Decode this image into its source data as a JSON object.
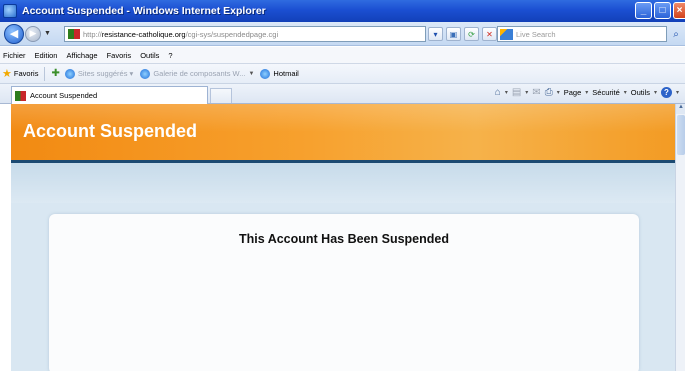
{
  "window": {
    "title": "Account Suspended - Windows Internet Explorer",
    "min_glyph": "_",
    "max_glyph": "□",
    "close_glyph": "×"
  },
  "address": {
    "url_prefix": "http://",
    "url_domain": "resistance-catholique.org",
    "url_path": "/cgi-sys/suspendedpage.cgi",
    "search_placeholder": "Live Search"
  },
  "menu": {
    "items": [
      "Fichier",
      "Edition",
      "Affichage",
      "Favoris",
      "Outils",
      "?"
    ]
  },
  "favorites": {
    "label": "Favoris",
    "links": [
      {
        "label": "Sites suggérés ▾",
        "dimmed": true
      },
      {
        "label": "Galerie de composants W...",
        "dimmed": true
      },
      {
        "label": "Hotmail",
        "dimmed": false
      }
    ]
  },
  "tabs": {
    "active_label": "Account Suspended"
  },
  "commandbar": {
    "page_label": "Page",
    "security_label": "Sécurité",
    "tools_label": "Outils"
  },
  "page": {
    "banner_title": "Account Suspended",
    "heading": "This Account Has Been Suspended"
  },
  "colors": {
    "banner": "#f7a12e",
    "titlebar": "#1b4fd2",
    "background": "#d9e7f2"
  }
}
